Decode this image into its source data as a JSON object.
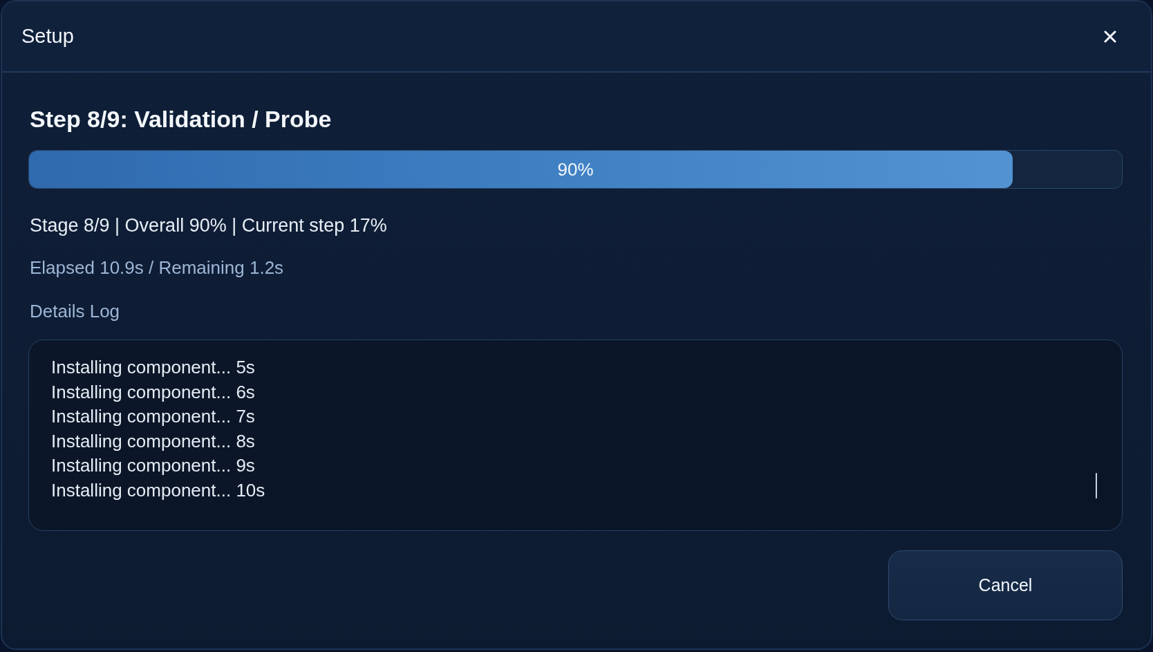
{
  "window": {
    "title": "Setup"
  },
  "step_title": "Step 8/9: Validation / Probe",
  "progress": {
    "level": 0.9,
    "label": "90%"
  },
  "stage_text": "Stage 8/9 | Overall 90% | Current step 17%",
  "time_text": "Elapsed 10.9s / Remaining 1.2s",
  "log": {
    "label": "Details Log",
    "lines": [
      "Installing component... 5s",
      "Installing component... 6s",
      "Installing component... 7s",
      "Installing component... 8s",
      "Installing component... 9s",
      "Installing component... 10s"
    ]
  },
  "buttons": [
    {
      "label": "Cancel",
      "kind": "secondary"
    }
  ]
}
